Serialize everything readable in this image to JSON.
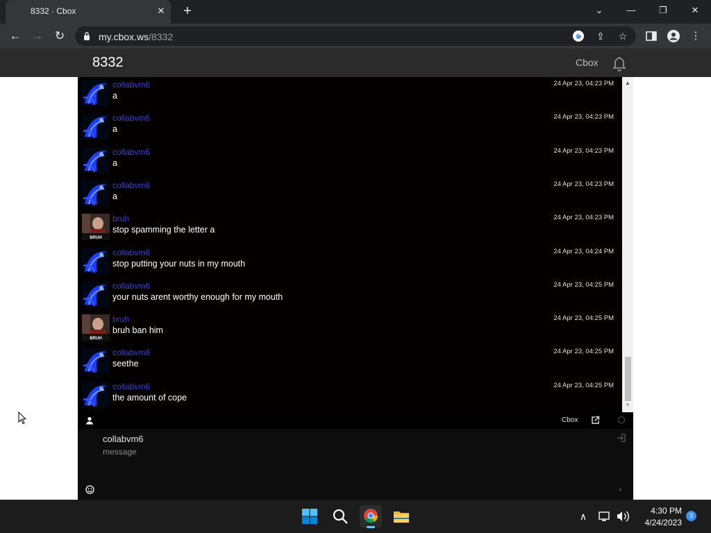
{
  "browser": {
    "tab_title": "8332 · Cbox",
    "tab_close": "✕",
    "new_tab": "+",
    "url_host": "my.cbox.ws",
    "url_path": "/8332",
    "minimize": "—",
    "maximize": "❐",
    "close": "✕",
    "dropdown": "⌄"
  },
  "site": {
    "title": "8332",
    "brand": "Cbox"
  },
  "messages": [
    {
      "user": "collabvm6",
      "text": "a",
      "time": "24 Apr 23, 04:23 PM",
      "avatar": "blue"
    },
    {
      "user": "collabvm6",
      "text": "a",
      "time": "24 Apr 23, 04:23 PM",
      "avatar": "blue"
    },
    {
      "user": "collabvm6",
      "text": "a",
      "time": "24 Apr 23, 04:23 PM",
      "avatar": "blue"
    },
    {
      "user": "collabvm6",
      "text": "a",
      "time": "24 Apr 23, 04:23 PM",
      "avatar": "blue"
    },
    {
      "user": "bruh",
      "text": "stop spamming the letter a",
      "time": "24 Apr 23, 04:23 PM",
      "avatar": "photo",
      "avatar_caption": "BRUH"
    },
    {
      "user": "collabvm6",
      "text": "stop putting your nuts in my mouth",
      "time": "24 Apr 23, 04:24 PM",
      "avatar": "blue"
    },
    {
      "user": "collabvm6",
      "text": "your nuts arent worthy enough for my mouth",
      "time": "24 Apr 23, 04:25 PM",
      "avatar": "blue"
    },
    {
      "user": "bruh",
      "text": "bruh ban him",
      "time": "24 Apr 23, 04:25 PM",
      "avatar": "photo",
      "avatar_caption": "BRUH"
    },
    {
      "user": "collabvm6",
      "text": "seethe",
      "time": "24 Apr 23, 04:25 PM",
      "avatar": "blue"
    },
    {
      "user": "collabvm6",
      "text": "the amount of cope",
      "time": "24 Apr 23, 04:25 PM",
      "avatar": "blue"
    }
  ],
  "chat_toolbar": {
    "cbox_link": "Cbox"
  },
  "input": {
    "name_value": "collabvm6",
    "message_placeholder": "message",
    "send_arrow": "▸"
  },
  "taskbar": {
    "time": "4:30 PM",
    "date": "4/24/2023",
    "notification_count": "3"
  },
  "colors": {
    "chat_bg": "#050000",
    "username": "#3d3dd6",
    "header_bg": "#2b2b2b"
  }
}
